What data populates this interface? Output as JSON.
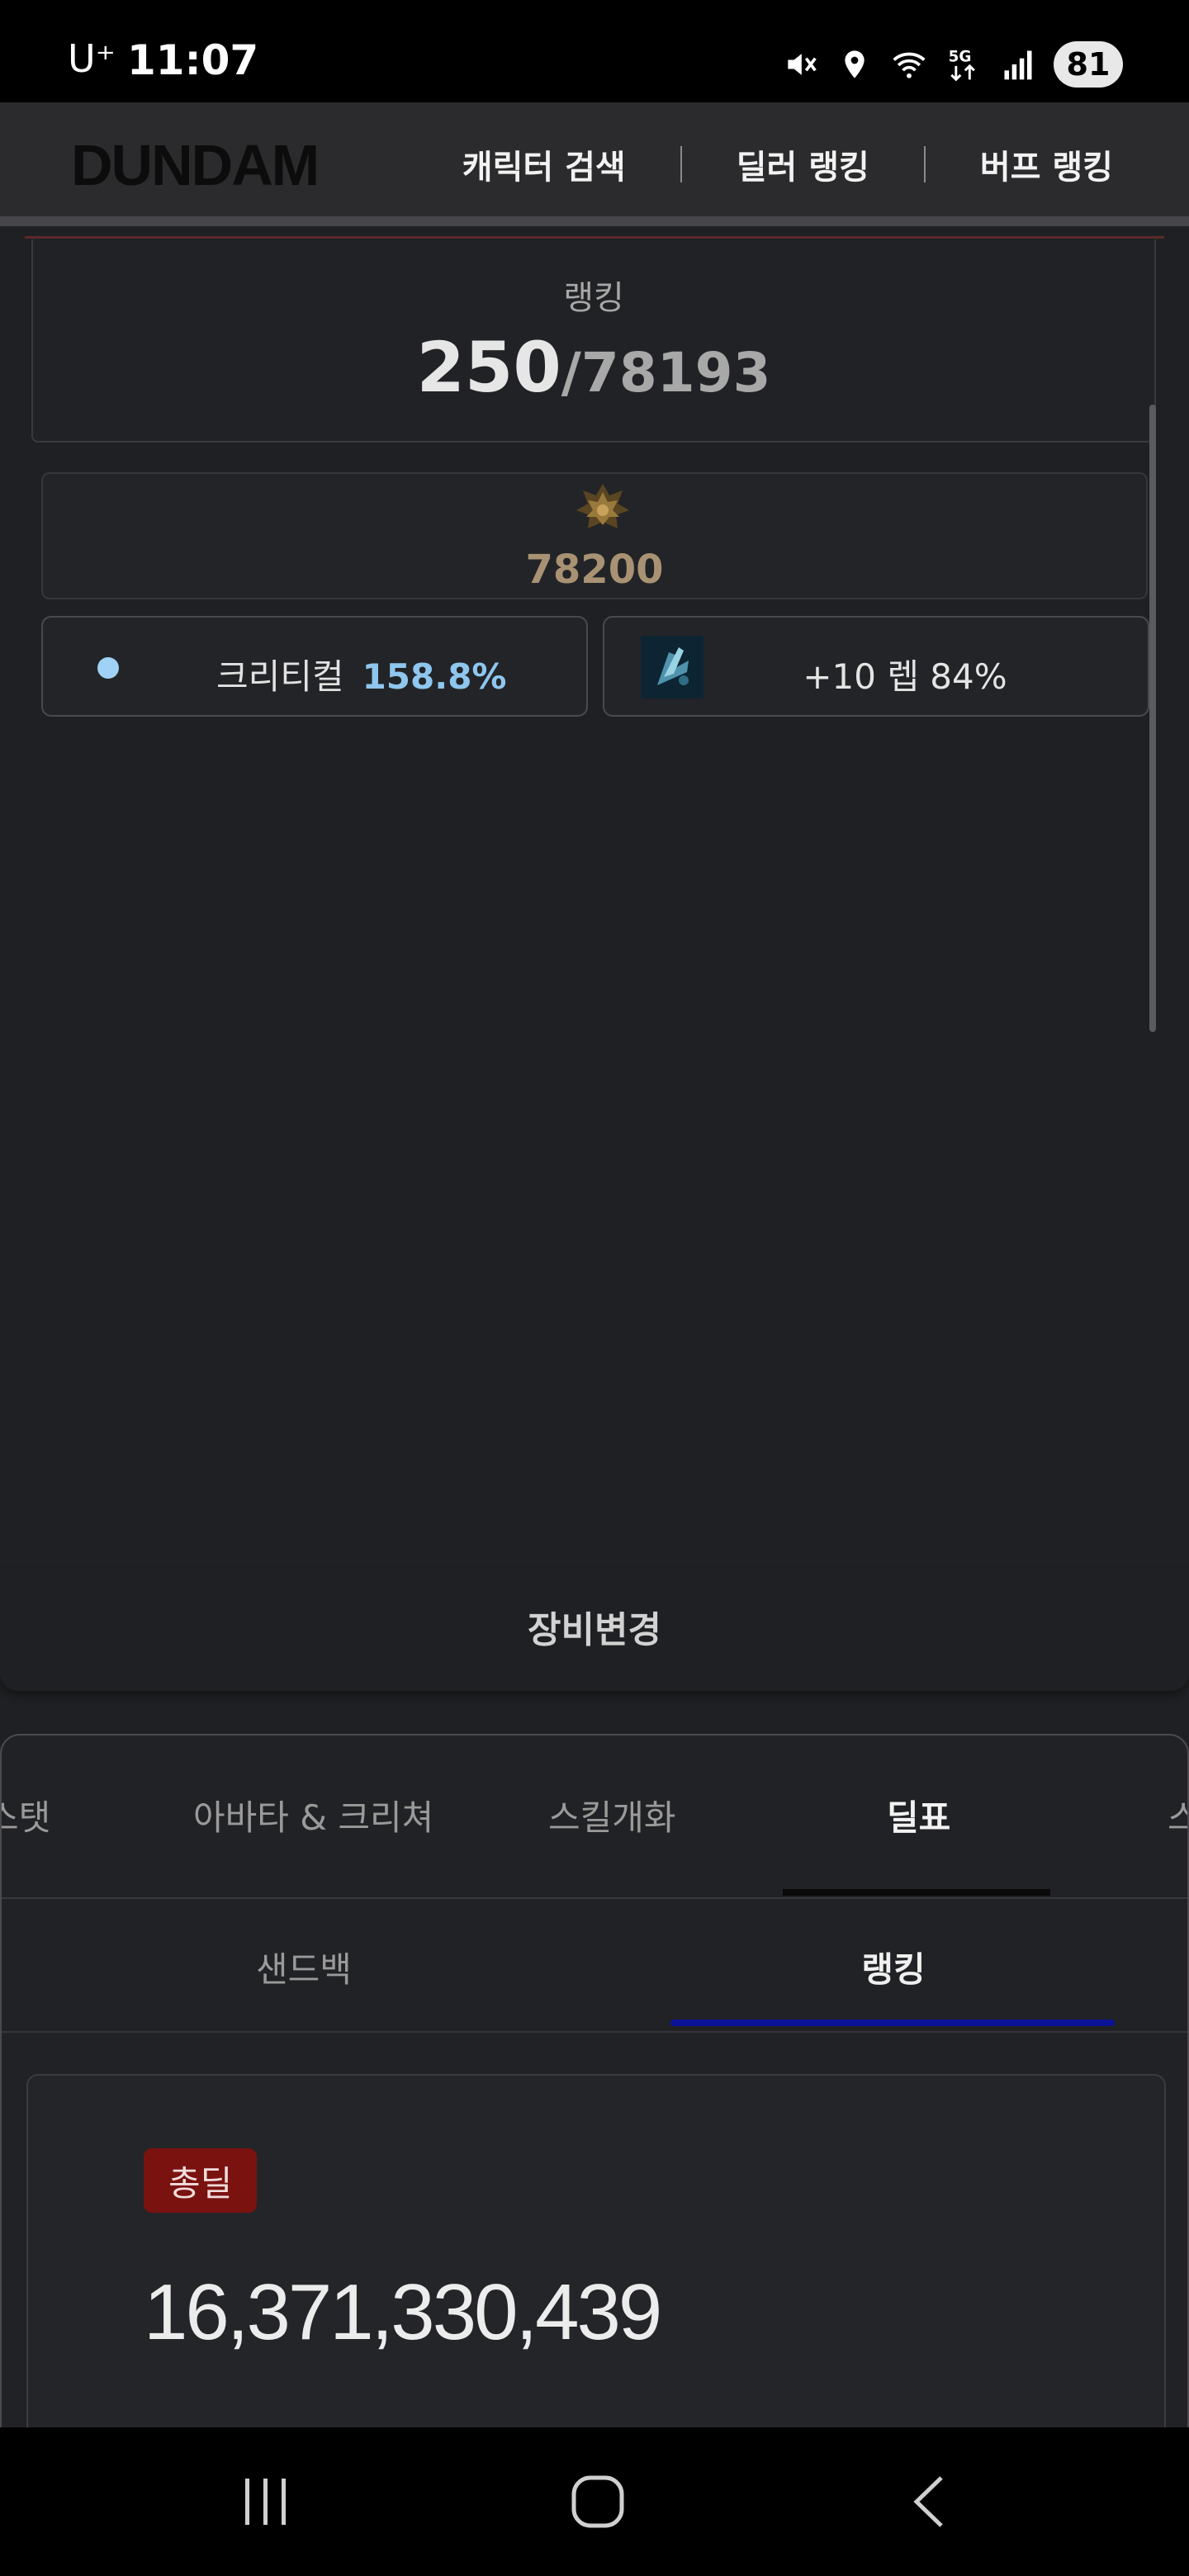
{
  "status_bar": {
    "carrier": "U⁺",
    "time": "11:07",
    "battery": "81",
    "icons": [
      "mute-icon",
      "location-icon",
      "wifi-icon",
      "5g-icon",
      "signal-icon"
    ]
  },
  "header": {
    "logo": "DUNDAM",
    "nav": [
      "캐릭터 검색",
      "딜러 랭킹",
      "버프 랭킹"
    ]
  },
  "ranking": {
    "title": "랭킹",
    "rank": "250",
    "total": "/78193"
  },
  "score": {
    "emblem": "rank-emblem-icon",
    "value": "78200"
  },
  "stats": {
    "crit_label": "크리티컬",
    "crit_value": "158.8%",
    "gear_text": "+10 렙 84%"
  },
  "equip_change": "장비변경",
  "tabs": {
    "main": [
      "스탯",
      "아바타 & 크리쳐",
      "스킬개화",
      "딜표",
      "스"
    ],
    "active_main": "딜표",
    "sub": [
      "샌드백",
      "랭킹"
    ],
    "active_sub": "랭킹"
  },
  "deal": {
    "badge": "총딜",
    "value": "16,371,330,439"
  },
  "colors": {
    "crit_accent": "#8ec6ee",
    "score_gold": "#a89273",
    "badge_red": "#7a1210",
    "sub_tab_accent": "#0b1298"
  }
}
